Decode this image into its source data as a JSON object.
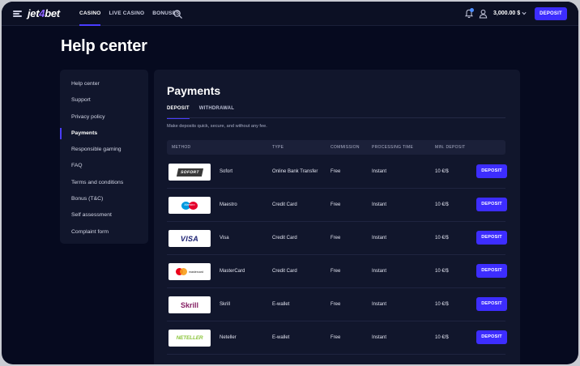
{
  "header": {
    "logo_main": "jet",
    "logo_accent": "4",
    "logo_end": "bet",
    "nav": [
      {
        "label": "CASINO",
        "active": true
      },
      {
        "label": "LIVE CASINO",
        "active": false
      },
      {
        "label": "BONUSES",
        "active": false
      }
    ],
    "balance": "3,000.00 $",
    "deposit_label": "DEPOSIT"
  },
  "page_title": "Help center",
  "sidebar": {
    "items": [
      {
        "label": "Help center",
        "active": false
      },
      {
        "label": "Support",
        "active": false
      },
      {
        "label": "Privacy policy",
        "active": false
      },
      {
        "label": "Payments",
        "active": true
      },
      {
        "label": "Responsible gaming",
        "active": false
      },
      {
        "label": "FAQ",
        "active": false
      },
      {
        "label": "Terms and conditions",
        "active": false
      },
      {
        "label": "Bonus (T&C)",
        "active": false
      },
      {
        "label": "Self assessment",
        "active": false
      },
      {
        "label": "Complaint form",
        "active": false
      }
    ]
  },
  "payments": {
    "title": "Payments",
    "tabs": [
      {
        "label": "DEPOSIT",
        "active": true
      },
      {
        "label": "WITHDRAWAL",
        "active": false
      }
    ],
    "description": "Make deposits quick, secure, and without any fee.",
    "columns": {
      "method": "METHOD",
      "type": "TYPE",
      "commission": "COMMISSION",
      "processing": "PROCESSING TIME",
      "min": "MIN. DEPOSIT"
    },
    "rows": [
      {
        "logo": "SOFORT",
        "name": "Sofort",
        "type": "Online Bank Transfer",
        "commission": "Free",
        "processing": "Instant",
        "min": "10 €/$",
        "action": "DEPOSIT"
      },
      {
        "logo": "Maestro",
        "name": "Maestro",
        "type": "Credit Card",
        "commission": "Free",
        "processing": "Instant",
        "min": "10 €/$",
        "action": "DEPOSIT"
      },
      {
        "logo": "VISA",
        "name": "Visa",
        "type": "Credit Card",
        "commission": "Free",
        "processing": "Instant",
        "min": "10 €/$",
        "action": "DEPOSIT"
      },
      {
        "logo": "mastercard",
        "name": "MasterCard",
        "type": "Credit Card",
        "commission": "Free",
        "processing": "Instant",
        "min": "10 €/$",
        "action": "DEPOSIT"
      },
      {
        "logo": "Skrill",
        "name": "Skrill",
        "type": "E-wallet",
        "commission": "Free",
        "processing": "Instant",
        "min": "10 €/$",
        "action": "DEPOSIT"
      },
      {
        "logo": "NETELLER",
        "name": "Neteller",
        "type": "E-wallet",
        "commission": "Free",
        "processing": "Instant",
        "min": "10 €/$",
        "action": "DEPOSIT"
      }
    ]
  },
  "colors": {
    "background": "#060a1f",
    "panel": "#11162c",
    "accent": "#3d2dff",
    "logo_accent": "#8d63ff"
  },
  "icons": [
    "menu-icon",
    "search-icon",
    "bell-icon",
    "user-icon",
    "chevron-down-icon"
  ]
}
